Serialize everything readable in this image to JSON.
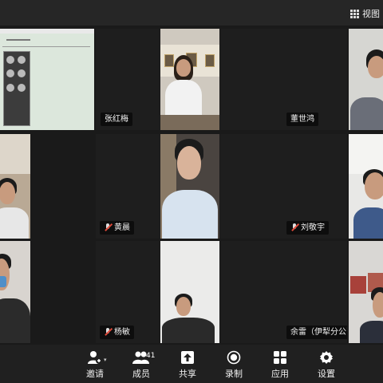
{
  "top_bar": {
    "view_label": "视图"
  },
  "participants": [
    {
      "name": "张红梅"
    },
    {
      "name": "董世鸿"
    },
    {
      "name": "黄晨"
    },
    {
      "name": "刘敬宇"
    },
    {
      "name": "杨敏"
    },
    {
      "name": "余雷（伊犁分公司）"
    }
  ],
  "toolbar": {
    "invite": "邀请",
    "members": "成员",
    "member_count": "41",
    "share": "共享",
    "record": "录制",
    "apps": "应用",
    "settings": "设置"
  },
  "icons": {
    "view": "grid-icon",
    "invite": "add-user-icon",
    "members": "members-icon",
    "share": "share-screen-icon",
    "record": "record-icon",
    "apps": "apps-icon",
    "settings": "gear-icon",
    "muted": "mic-muted-icon"
  }
}
